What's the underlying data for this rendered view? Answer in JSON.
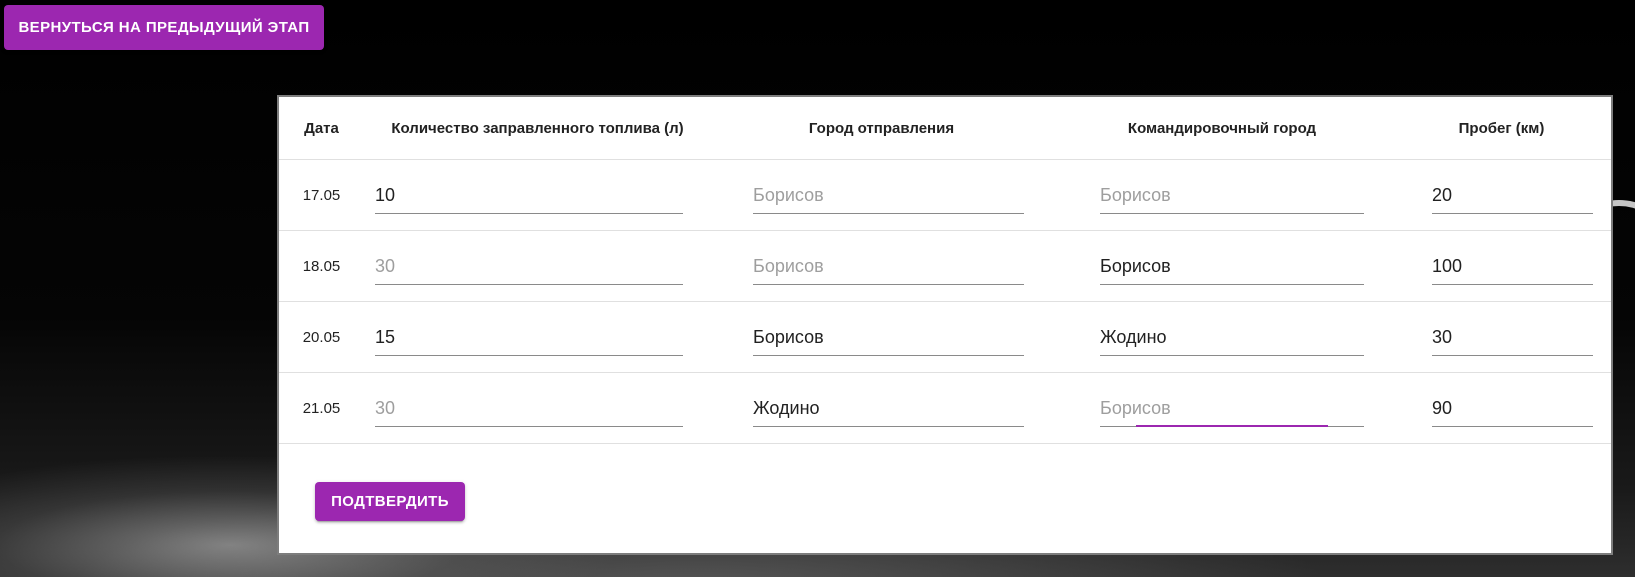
{
  "back_button": {
    "label": "Вернуться на предыдущий этап"
  },
  "table": {
    "headers": [
      "Дата",
      "Количество заправленного топлива (л)",
      "Город отправления",
      "Командировочный город",
      "Пробег (км)"
    ],
    "rows": [
      {
        "date": "17.05",
        "fuel": {
          "value": "10",
          "placeholder": ""
        },
        "departure": {
          "value": "",
          "placeholder": "Борисов"
        },
        "destination": {
          "value": "",
          "placeholder": "Борисов"
        },
        "mileage": {
          "value": "20",
          "placeholder": ""
        }
      },
      {
        "date": "18.05",
        "fuel": {
          "value": "",
          "placeholder": "30"
        },
        "departure": {
          "value": "",
          "placeholder": "Борисов"
        },
        "destination": {
          "value": "Борисов",
          "placeholder": ""
        },
        "mileage": {
          "value": "100",
          "placeholder": ""
        }
      },
      {
        "date": "20.05",
        "fuel": {
          "value": "15",
          "placeholder": ""
        },
        "departure": {
          "value": "Борисов",
          "placeholder": ""
        },
        "destination": {
          "value": "Жодино",
          "placeholder": ""
        },
        "mileage": {
          "value": "30",
          "placeholder": ""
        }
      },
      {
        "date": "21.05",
        "fuel": {
          "value": "",
          "placeholder": "30"
        },
        "departure": {
          "value": "Жодино",
          "placeholder": ""
        },
        "destination": {
          "value": "",
          "placeholder": "Борисов"
        },
        "mileage": {
          "value": "90",
          "placeholder": ""
        }
      }
    ]
  },
  "confirm_button": {
    "label": "Подтвердить"
  },
  "colors": {
    "accent": "#9c27b0",
    "text": "#212121",
    "placeholder": "#9e9e9e"
  }
}
